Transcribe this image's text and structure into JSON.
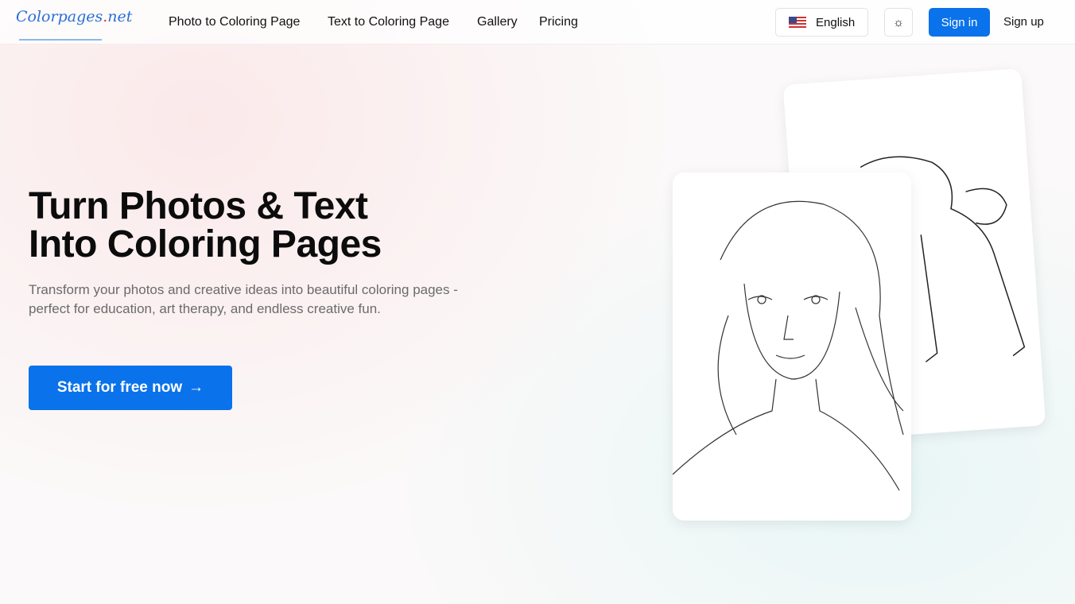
{
  "header": {
    "logo": "Colorpages.net",
    "nav": [
      "Photo to Coloring Page",
      "Text to Coloring Page",
      "Gallery",
      "Pricing"
    ],
    "language": "English",
    "sign_in": "Sign in",
    "sign_up": "Sign up"
  },
  "hero": {
    "title_line1": "Turn Photos & Text",
    "title_line2": "Into Coloring Pages",
    "subtitle": "Transform your photos and creative ideas into beautiful coloring pages - perfect for education, art therapy, and endless creative fun.",
    "cta": "Start for free now",
    "cta_arrow": "→"
  }
}
